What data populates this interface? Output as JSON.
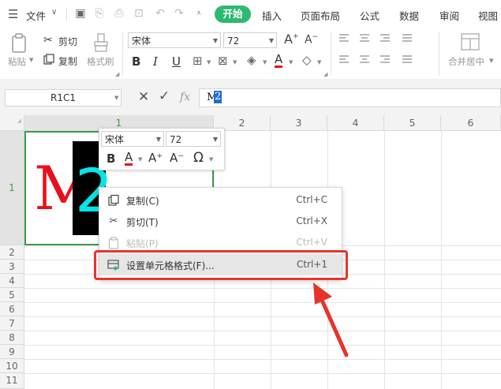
{
  "menubar": {
    "file_label": "文件",
    "tabs": [
      "开始",
      "插入",
      "页面布局",
      "公式",
      "数据",
      "审阅",
      "视图"
    ]
  },
  "ribbon": {
    "paste": "粘贴",
    "cut": "剪切",
    "copy": "复制",
    "format_painter": "格式刷",
    "font_name": "宋体",
    "font_size": "72",
    "merge_center": "合并居中",
    "bold": "B",
    "italic": "I",
    "underline": "U",
    "font_color_glyph": "A"
  },
  "formula_bar": {
    "name_box": "R1C1",
    "fx": "fx",
    "content_plain": "M",
    "content_selected": "2"
  },
  "grid": {
    "columns": [
      "1",
      "2",
      "3",
      "4",
      "5",
      "6"
    ],
    "rows": [
      "1",
      "2",
      "3",
      "4",
      "5",
      "6",
      "7",
      "8",
      "9",
      "10",
      "11"
    ],
    "cell_r1c1": {
      "char1": "M",
      "char2": "2",
      "char1_color": "#e8101a",
      "char2_color": "#00e6ea",
      "char2_bg": "#000000"
    }
  },
  "mini_toolbar": {
    "font_name": "宋体",
    "font_size": "72",
    "bold": "B",
    "font_color_glyph": "A",
    "grow_font": "A⁺",
    "shrink_font": "A⁻",
    "symbol": "Ω"
  },
  "context_menu": {
    "items": [
      {
        "label": "复制(C)",
        "shortcut": "Ctrl+C",
        "enabled": true
      },
      {
        "label": "剪切(T)",
        "shortcut": "Ctrl+X",
        "enabled": true
      },
      {
        "label": "粘贴(P)",
        "shortcut": "Ctrl+V",
        "enabled": false
      },
      {
        "label": "设置单元格格式(F)...",
        "shortcut": "Ctrl+1",
        "enabled": true,
        "highlighted": true
      }
    ]
  },
  "colors": {
    "accent_green": "#2eb870",
    "annotation_red": "#e8332b",
    "selection_green": "#3c9c4c"
  },
  "icons": [
    "menu-icon",
    "save-icon",
    "undo-icon",
    "redo-icon",
    "print-icon",
    "preview-icon",
    "scissors-icon",
    "copy-icon",
    "paste-icon",
    "brush-icon",
    "omega-icon",
    "format-cells-icon",
    "arrow-annotation"
  ]
}
